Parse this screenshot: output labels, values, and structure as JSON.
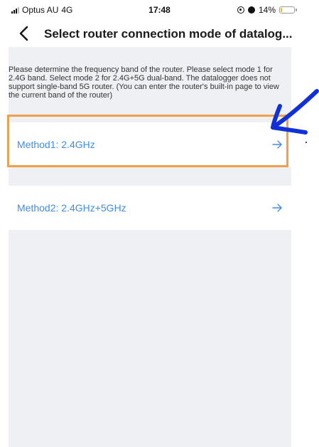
{
  "status_bar": {
    "carrier": "Optus AU",
    "network": "4G",
    "time": "17:48",
    "battery_text": "14%",
    "battery_level": 0.14
  },
  "nav": {
    "title": "Select router connection mode of datalog...",
    "back_icon": "chevron-left-icon"
  },
  "description": "Please determine the frequency band of the router. Please select mode 1 for 2.4G band. Select mode 2 for 2.4G+5G dual-band. The datalogger does not support single-band 5G router. (You can enter the router's built-in page to view the current band of the router)",
  "methods": [
    {
      "label": "Method1: 2.4GHz",
      "icon": "arrow-right-icon"
    },
    {
      "label": "Method2: 2.4GHz+5GHz",
      "icon": "arrow-right-icon"
    }
  ],
  "colors": {
    "accent": "#3f8de6",
    "panel_background": "#eef0f4",
    "highlight": "#f0a04b",
    "annotation": "#1030d8"
  }
}
